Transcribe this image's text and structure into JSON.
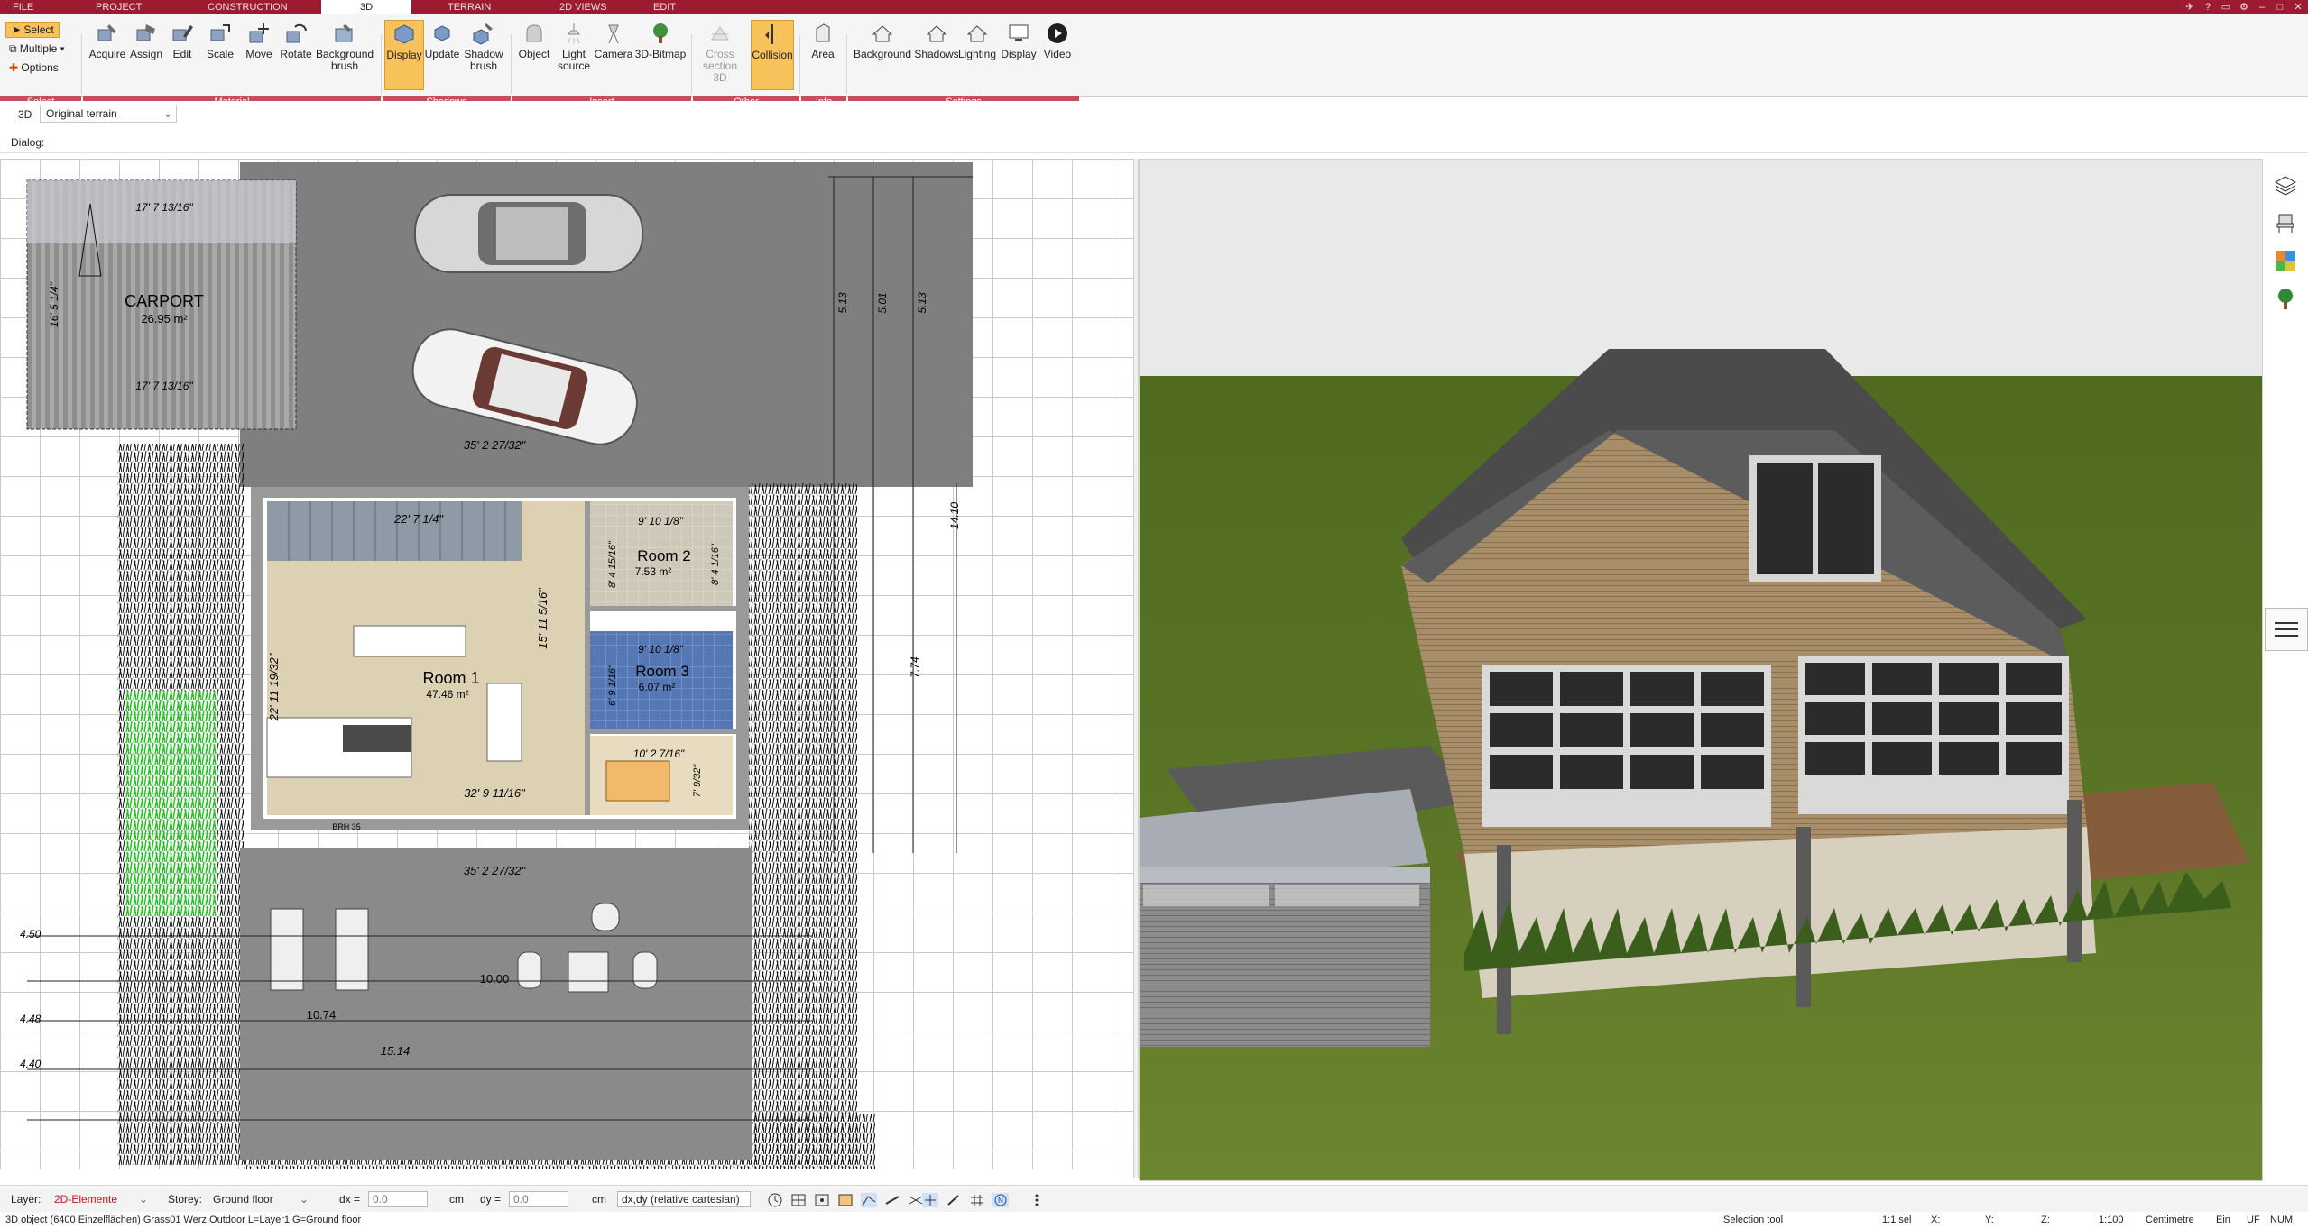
{
  "menu": {
    "tabs": [
      {
        "label": "FILE",
        "active": false
      },
      {
        "label": "PROJECT",
        "active": false
      },
      {
        "label": "CONSTRUCTION",
        "active": false
      },
      {
        "label": "3D",
        "active": true
      },
      {
        "label": "TERRAIN",
        "active": false
      },
      {
        "label": "2D VIEWS",
        "active": false
      },
      {
        "label": "EDIT",
        "active": false
      }
    ],
    "brand_color": "#9c1b30"
  },
  "ribbon": {
    "select": {
      "select_label": "Select",
      "multiple_label": "Multiple",
      "options_label": "Options"
    },
    "material": [
      {
        "label": "Acquire",
        "icon": "acquire-icon"
      },
      {
        "label": "Assign",
        "icon": "assign-icon"
      },
      {
        "label": "Edit",
        "icon": "edit-icon"
      },
      {
        "label": "Scale",
        "icon": "scale-icon"
      },
      {
        "label": "Move",
        "icon": "move-icon"
      },
      {
        "label": "Rotate",
        "icon": "rotate-icon"
      },
      {
        "label": "Background brush",
        "icon": "background-brush-icon"
      }
    ],
    "shadows": [
      {
        "label": "Display",
        "icon": "display-icon",
        "active": true
      },
      {
        "label": "Update",
        "icon": "update-icon"
      },
      {
        "label": "Shadow brush",
        "icon": "shadow-brush-icon"
      }
    ],
    "insert": [
      {
        "label": "Object",
        "icon": "object-icon"
      },
      {
        "label": "Light source",
        "icon": "light-source-icon"
      },
      {
        "label": "Camera",
        "icon": "camera-icon"
      },
      {
        "label": "3D-Bitmap",
        "icon": "tree-bitmap-icon"
      }
    ],
    "other": [
      {
        "label": "Cross section 3D",
        "icon": "cross-section-icon",
        "disabled": true
      },
      {
        "label": "Collision",
        "icon": "collision-icon",
        "active": true
      }
    ],
    "info": [
      {
        "label": "Area",
        "icon": "area-icon"
      }
    ],
    "settings": [
      {
        "label": "Background",
        "icon": "background-icon"
      },
      {
        "label": "Shadows",
        "icon": "shadows-icon"
      },
      {
        "label": "Lighting",
        "icon": "lighting-icon"
      },
      {
        "label": "Display",
        "icon": "display-settings-icon"
      },
      {
        "label": "Video",
        "icon": "video-icon"
      }
    ],
    "groups": [
      "Select",
      "Material",
      "Shadows",
      "Insert",
      "Other",
      "Info",
      "Settings"
    ],
    "group_color": "#c94c5e"
  },
  "viewbar": {
    "mode": "3D",
    "terrain_select": "Original terrain"
  },
  "dialogbar": {
    "label": "Dialog:"
  },
  "plan": {
    "carport": {
      "name": "CARPORT",
      "area": "26.95 m²",
      "width_dim": "17' 7 13/16\"",
      "height_dim": "16' 5 1/4\""
    },
    "rooms": [
      {
        "name": "Room 1",
        "area": "47.46 m²"
      },
      {
        "name": "Room 2",
        "area": "7.53 m²"
      },
      {
        "name": "Room 3",
        "area": "6.07 m²"
      }
    ],
    "dimensions": {
      "drive_width": "35' 2 27/32\"",
      "house_width": "35' 2 27/32\"",
      "top_wall": "22' 7 1/4\"",
      "room2_top": "9' 10 1/8\"",
      "room3_top": "9' 10 1/8\"",
      "vertical_1": "15' 11 5/16\"",
      "room1_left": "22' 11 19/32\"",
      "bottom_inner": "32' 9 11/16\"",
      "kitchen_top": "10' 2 7/16\"",
      "room2_side": "8' 4 15/16\"",
      "room2_side_r": "8' 4 1/16\"",
      "room3_side": "6' 9 1/16\"",
      "dining_side": "7' 9/32\"",
      "total_vertical": "14.10",
      "right_vertical": "7.74",
      "right_513a": "5.13",
      "right_501": "5.01",
      "right_513b": "5.13",
      "bottom_total": "15.14",
      "terrace_1074": "10.74",
      "terrace_1000": "10.00",
      "left_440": "4.40",
      "left_448": "4.48",
      "left_450": "4.50",
      "brh": "BRH 35"
    }
  },
  "bottombar": {
    "layer_label": "Layer:",
    "layer_value": "2D-Elemente",
    "storey_label": "Storey:",
    "storey_value": "Ground floor",
    "dx_label": "dx =",
    "dx_value": "0.0",
    "dy_label": "dy =",
    "dy_value": "0.0",
    "unit": "cm",
    "coord_mode": "dx,dy (relative cartesian)"
  },
  "status": {
    "left": "3D object (6400 Einzelflächen) Grass01 Werz Outdoor L=Layer1 G=Ground floor",
    "tool": "Selection tool",
    "sel": "1:1 sel",
    "x": "X:",
    "y": "Y:",
    "z": "Z:",
    "scale": "1:100",
    "units": "Centimetre",
    "ein": "Ein",
    "uf": "UF",
    "num": "NUM"
  }
}
